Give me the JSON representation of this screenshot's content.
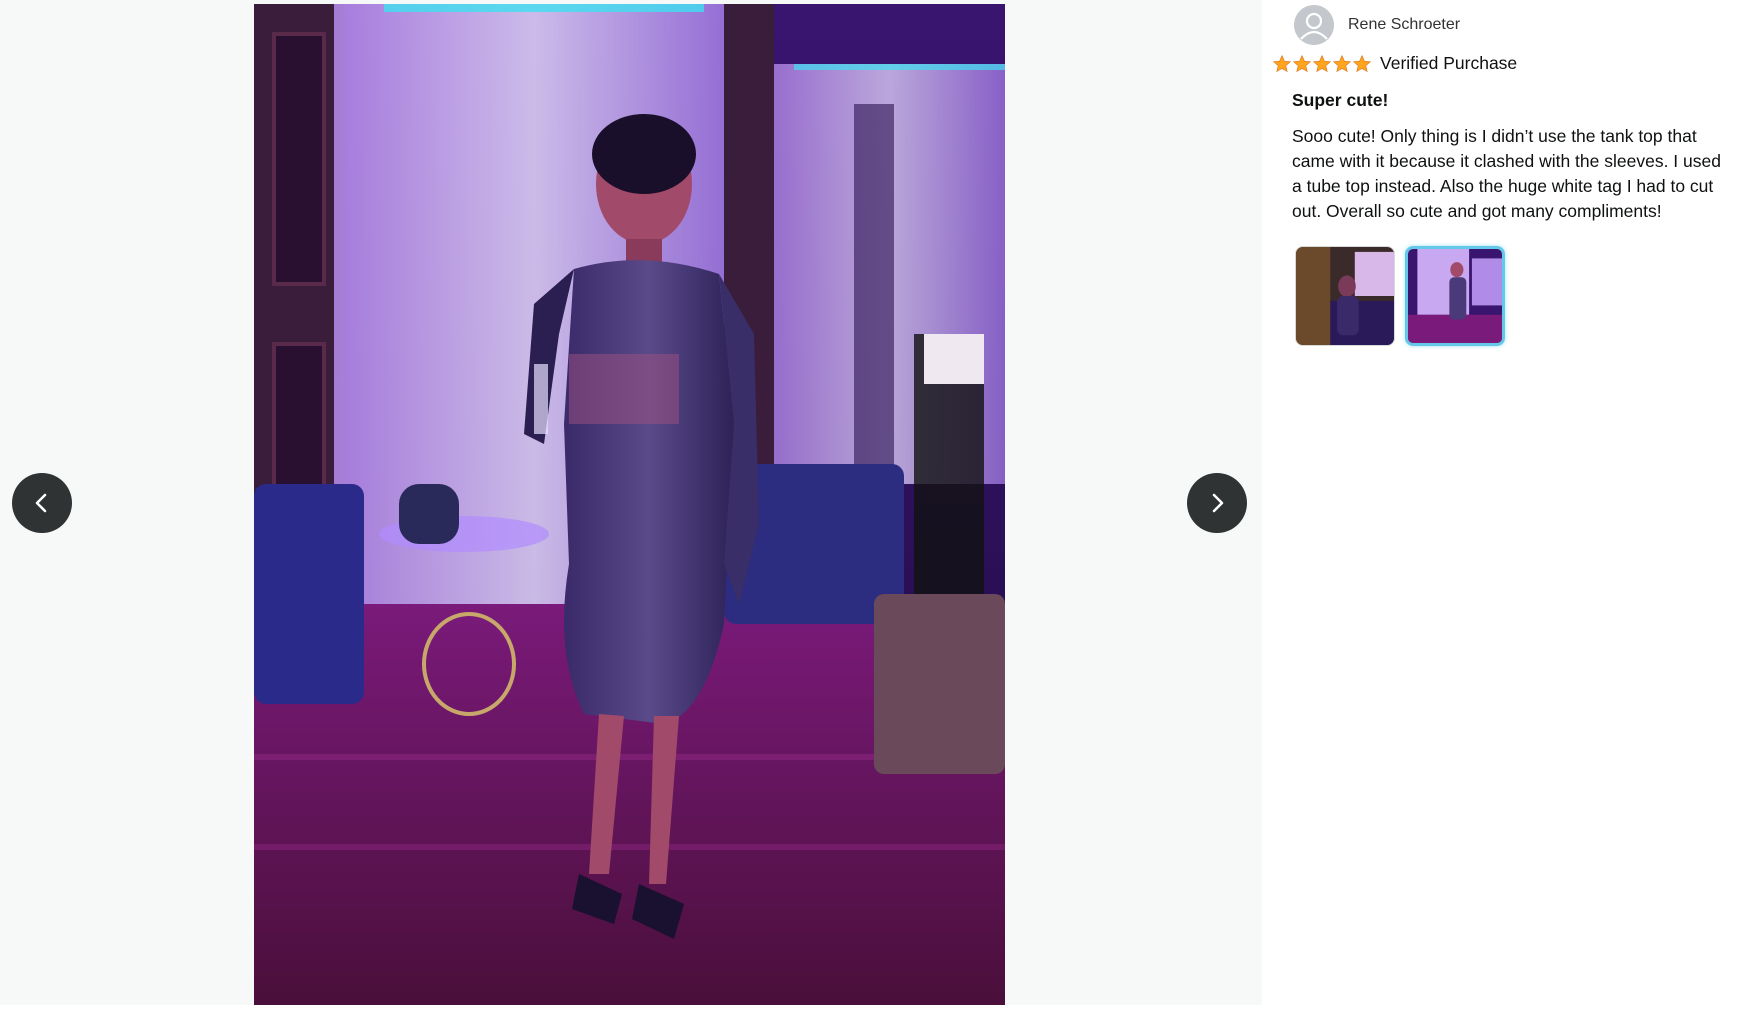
{
  "viewer": {
    "prev_icon": "chevron-left-icon",
    "next_icon": "chevron-right-icon"
  },
  "review": {
    "reviewer_name": "Rene Schroeter",
    "avatar_icon": "user-avatar-icon",
    "rating": 5,
    "rating_max": 5,
    "star_color": "#ffa41c",
    "verified_label": "Verified Purchase",
    "title": "Super cute!",
    "body": "Sooo cute! Only thing is I didn’t use the tank top that came with it because it clashed with the sleeves. I used a tube top instead. Also the huge white tag I had to cut out. Overall so cute and got many compliments!",
    "selected_thumbnail": 2
  },
  "colors": {
    "nav_button_bg": "#303333",
    "selected_border": "#64c8e8",
    "viewer_bg": "#f7f8f8"
  }
}
